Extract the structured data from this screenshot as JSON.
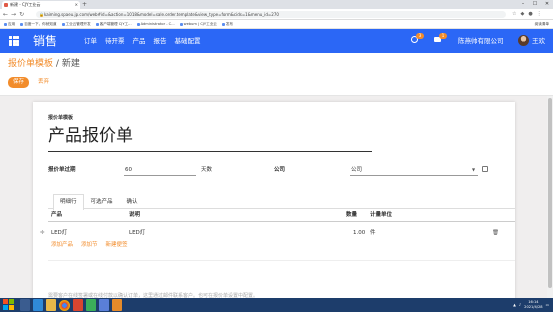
{
  "browser": {
    "tab_title": "新建 - CJY工业云",
    "tab_close": "×",
    "new_tab": "+",
    "nav": {
      "back": "←",
      "forward": "→",
      "reload": "↻"
    },
    "url": "kaiming.spaeu.jp.com/web#id=&action=1018&model=sale.order.template&view_type=form&cids=1&menu_id=270",
    "bookmarks": [
      "应用",
      "百度一下，你就知道",
      "工业云管理开发",
      "客户端管理 CJY工...",
      "Administrator - C...",
      "webum | CJY工业云",
      "发布"
    ],
    "bookmarks_right": "阅读清单"
  },
  "appbar": {
    "brand": "销售",
    "menu": [
      "订单",
      "待开票",
      "产品",
      "报告",
      "基础配置"
    ],
    "activity_count": "3",
    "message_count": "1",
    "company": "陈燕帅有限公司",
    "user": "王欢"
  },
  "control": {
    "breadcrumb_parent": "报价单模板",
    "breadcrumb_sep": "/",
    "breadcrumb_current": "新建",
    "save_label": "保存",
    "discard_label": "丢弃"
  },
  "form": {
    "template_label": "报价单模板",
    "title_value": "产品报价单",
    "validity_label": "报价单过期",
    "validity_value": "60",
    "validity_unit": "天数",
    "company_label": "公司",
    "company_value": "公司"
  },
  "notebook": {
    "tabs": [
      "明细行",
      "可选产品",
      "确认"
    ],
    "columns": {
      "product": "产品",
      "description": "说明",
      "quantity": "数量",
      "uom": "计量单位"
    },
    "rows": [
      {
        "product": "LED灯",
        "description": "LED灯",
        "quantity": "1.00",
        "uom": "件"
      }
    ],
    "actions": [
      "添加产品",
      "添加节",
      "新建便签"
    ]
  },
  "footer_hint": "需要客户在线签署或在线付款以确认订单，这里通过邮件联系客户。也可在报价单设置中配置。",
  "taskbar": {
    "time": "16:14",
    "date": "2021/4/28"
  },
  "colors": {
    "primary": "#2b67f6",
    "accent": "#f28c2b",
    "taskbar": "#1d3d6b"
  }
}
